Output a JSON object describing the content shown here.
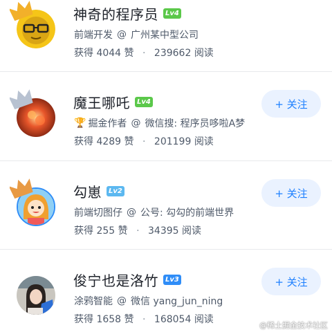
{
  "colors": {
    "accent": "#1e80ff",
    "follow_bg": "#eaf2ff",
    "lv4": "#5bc84a",
    "lv2": "#5cb8f0",
    "lv3": "#2f8df7",
    "crown_gold": "#f2b02a",
    "crown_silver": "#b8c2d1",
    "crown_bronze": "#e89a44"
  },
  "users": [
    {
      "name": "神奇的程序员",
      "level": "Lv4",
      "company": "广州某中型公司",
      "job": "前端开发",
      "likes_label": "获得",
      "likes": "4044",
      "likes_unit": "赞",
      "reads": "239662",
      "reads_unit": "阅读",
      "crown": "crown-gold-icon",
      "follow": ""
    },
    {
      "name": "魔王哪吒",
      "level": "Lv4",
      "job": "掘金作者",
      "company": "微信搜: 程序员哆啦A梦",
      "likes_label": "获得",
      "likes": "4289",
      "likes_unit": "赞",
      "reads": "201199",
      "reads_unit": "阅读",
      "crown": "crown-silver-icon",
      "follow": "+ 关注"
    },
    {
      "name": "勾崽",
      "level": "Lv2",
      "job": "前端切图仔",
      "company": "公号: 勾勾的前端世界",
      "likes_label": "获得",
      "likes": "255",
      "likes_unit": "赞",
      "reads": "34395",
      "reads_unit": "阅读",
      "crown": "crown-bronze-icon",
      "follow": "+ 关注"
    },
    {
      "name": "俊宁也是洛竹",
      "level": "Lv3",
      "job": "涂鸦智能",
      "company": "微信 yang_jun_ning",
      "likes_label": "获得",
      "likes": "1658",
      "likes_unit": "赞",
      "reads": "168054",
      "reads_unit": "阅读",
      "crown": "",
      "follow": "+ 关注"
    }
  ],
  "separator": "@",
  "stat_dot": "·",
  "watermark": "@稀土掘金技术社区"
}
